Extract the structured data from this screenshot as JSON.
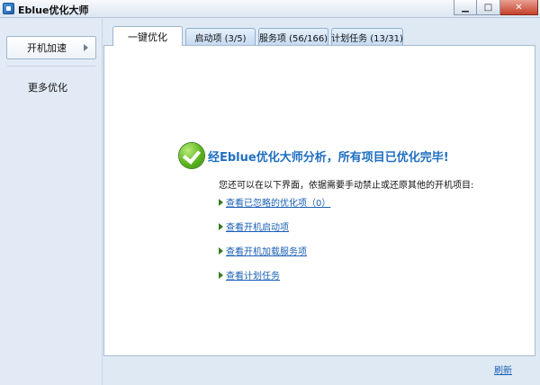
{
  "window": {
    "title": "Eblue优化大师",
    "minimize_icon": "minimize-icon",
    "maximize_icon": "maximize-icon",
    "close_icon": "close-icon"
  },
  "sidebar": {
    "items": [
      {
        "label": "开机加速",
        "active": true
      },
      {
        "label": "更多优化",
        "active": false
      }
    ]
  },
  "tabs": [
    {
      "label": "一键优化",
      "active": true
    },
    {
      "label": "启动项 (3/5)",
      "active": false
    },
    {
      "label": "服务项 (56/166)",
      "active": false
    },
    {
      "label": "计划任务 (13/31)",
      "active": false
    }
  ],
  "main": {
    "status_icon": "check-circle-icon",
    "headline": "经Eblue优化大师分析，所有项目已优化完毕!",
    "subtext": "您还可以在以下界面，依据需要手动禁止或还原其他的开机项目:",
    "links": [
      "查看已忽略的优化项（0）",
      "查看开机启动项",
      "查看开机加载服务项",
      "查看计划任务"
    ]
  },
  "footer": {
    "refresh_label": "刷新"
  },
  "colors": {
    "accent_blue": "#1f6fc0",
    "link_blue": "#1a5fb4",
    "ok_green": "#5bb51f",
    "sidebar_bg": "#e2ebf5"
  }
}
